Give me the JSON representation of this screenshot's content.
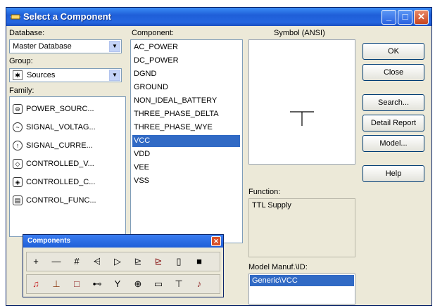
{
  "window": {
    "title": "Select a Component",
    "controls": {
      "minimize": "_",
      "maximize": "□",
      "close": "✕"
    }
  },
  "database": {
    "label": "Database:",
    "value": "Master Database"
  },
  "group": {
    "label": "Group:",
    "value": "Sources",
    "icon": "ground-source-icon"
  },
  "family": {
    "label": "Family:",
    "items": [
      {
        "label": "POWER_SOURC...",
        "icon": "power-source-icon"
      },
      {
        "label": "SIGNAL_VOLTAG...",
        "icon": "signal-voltage-icon"
      },
      {
        "label": "SIGNAL_CURRE...",
        "icon": "signal-current-icon"
      },
      {
        "label": "CONTROLLED_V...",
        "icon": "controlled-voltage-icon"
      },
      {
        "label": "CONTROLLED_C...",
        "icon": "controlled-current-icon"
      },
      {
        "label": "CONTROL_FUNC...",
        "icon": "control-function-icon"
      }
    ]
  },
  "component": {
    "label": "Component:",
    "items": [
      "AC_POWER",
      "DC_POWER",
      "DGND",
      "GROUND",
      "NON_IDEAL_BATTERY",
      "THREE_PHASE_DELTA",
      "THREE_PHASE_WYE",
      "VCC",
      "VDD",
      "VEE",
      "VSS"
    ],
    "selected": "VCC"
  },
  "symbol": {
    "label": "Symbol (ANSI)"
  },
  "function": {
    "label": "Function:",
    "value": "TTL Supply"
  },
  "model": {
    "label": "Model Manuf.\\ID:",
    "value": "Generic\\VCC"
  },
  "buttons": {
    "ok": "OK",
    "close": "Close",
    "search": "Search...",
    "detail": "Detail Report",
    "model": "Model...",
    "help": "Help"
  },
  "toolbar": {
    "title": "Components",
    "close": "✕",
    "row1": [
      "+",
      "—",
      "#",
      "⩤",
      "▷",
      "⊵",
      "⊵",
      "▯",
      "■"
    ],
    "row2": [
      "♫",
      "⊥",
      "□",
      "⊷",
      "Y",
      "⊕",
      "▭",
      "⊤",
      "♪"
    ]
  },
  "colors": {
    "titlebar": "#2466e0",
    "selection": "#316ac5",
    "window_bg": "#ece9d8"
  }
}
